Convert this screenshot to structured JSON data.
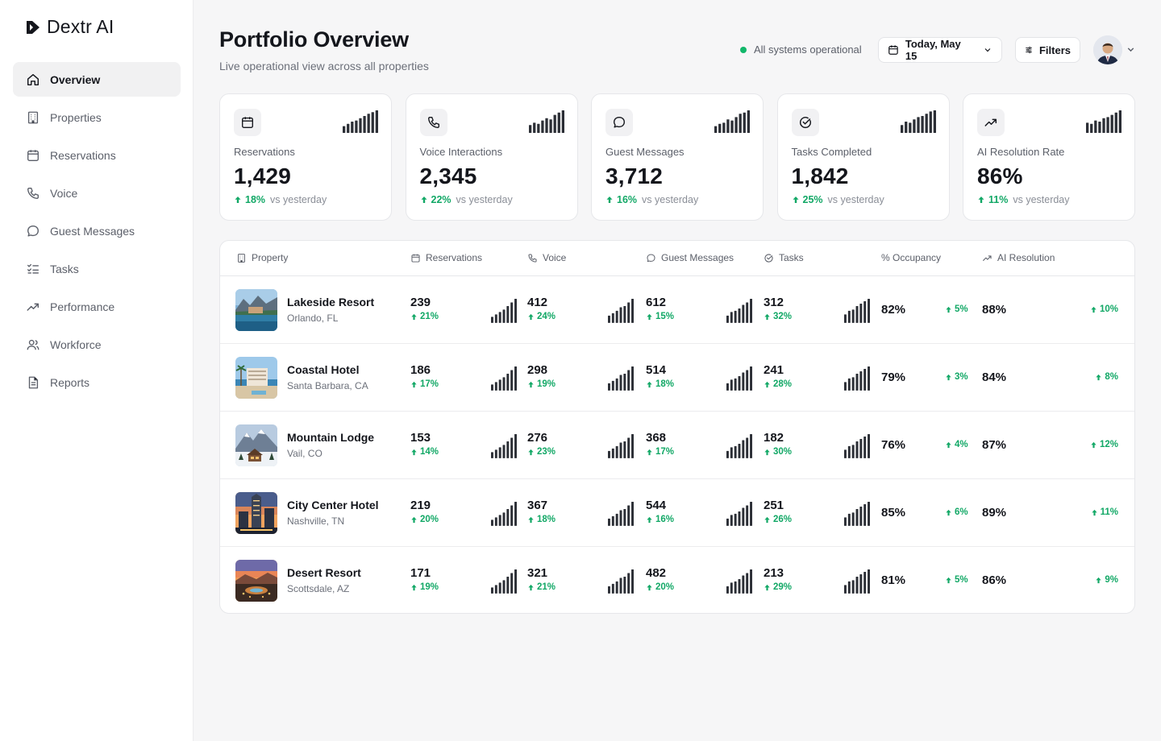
{
  "brand": {
    "name": "Dextr AI"
  },
  "sidebar": {
    "items": [
      {
        "label": "Overview",
        "icon": "home-icon",
        "active": true
      },
      {
        "label": "Properties",
        "icon": "building-icon"
      },
      {
        "label": "Reservations",
        "icon": "calendar-icon"
      },
      {
        "label": "Voice",
        "icon": "phone-icon"
      },
      {
        "label": "Guest Messages",
        "icon": "chat-bubble-icon"
      },
      {
        "label": "Tasks",
        "icon": "checklist-icon"
      },
      {
        "label": "Performance",
        "icon": "trend-up-icon"
      },
      {
        "label": "Workforce",
        "icon": "users-icon"
      },
      {
        "label": "Reports",
        "icon": "document-icon"
      }
    ]
  },
  "header": {
    "title": "Portfolio Overview",
    "subtitle": "Live operational view across all properties",
    "status": "All systems operational",
    "date_label": "Today, May 15",
    "filters_label": "Filters"
  },
  "kpis": [
    {
      "label": "Reservations",
      "value": "1,429",
      "delta": "18%",
      "vs": "vs yesterday",
      "icon": "calendar-icon",
      "spark": [
        0.3,
        0.4,
        0.5,
        0.55,
        0.65,
        0.75,
        0.85,
        0.92,
        1.0
      ]
    },
    {
      "label": "Voice Interactions",
      "value": "2,345",
      "delta": "22%",
      "vs": "vs yesterday",
      "icon": "phone-icon",
      "spark": [
        0.35,
        0.45,
        0.4,
        0.55,
        0.65,
        0.6,
        0.8,
        0.9,
        1.0
      ]
    },
    {
      "label": "Guest Messages",
      "value": "3,712",
      "delta": "16%",
      "vs": "vs yesterday",
      "icon": "chat-bubble-icon",
      "spark": [
        0.3,
        0.4,
        0.45,
        0.6,
        0.55,
        0.7,
        0.85,
        0.9,
        1.0
      ]
    },
    {
      "label": "Tasks Completed",
      "value": "1,842",
      "delta": "25%",
      "vs": "vs yesterday",
      "icon": "check-circle-icon",
      "spark": [
        0.35,
        0.5,
        0.45,
        0.6,
        0.7,
        0.75,
        0.85,
        0.95,
        1.0
      ]
    },
    {
      "label": "AI Resolution Rate",
      "value": "86%",
      "delta": "11%",
      "vs": "vs yesterday",
      "icon": "trend-up-icon",
      "spark": [
        0.45,
        0.4,
        0.55,
        0.5,
        0.65,
        0.7,
        0.8,
        0.9,
        1.0
      ]
    }
  ],
  "table": {
    "columns": [
      {
        "label": "Property",
        "icon": "building-icon"
      },
      {
        "label": "Reservations",
        "icon": "calendar-icon"
      },
      {
        "label": "Voice",
        "icon": "phone-icon"
      },
      {
        "label": "Guest Messages",
        "icon": "chat-bubble-icon"
      },
      {
        "label": "Tasks",
        "icon": "check-circle-icon"
      },
      {
        "label": "% Occupancy",
        "icon": ""
      },
      {
        "label": "AI Resolution",
        "icon": "trend-up-icon"
      }
    ],
    "rows": [
      {
        "name": "Lakeside Resort",
        "location": "Orlando, FL",
        "scene": "lake",
        "reservations": {
          "value": "239",
          "delta": "21%"
        },
        "voice": {
          "value": "412",
          "delta": "24%"
        },
        "messages": {
          "value": "612",
          "delta": "15%"
        },
        "tasks": {
          "value": "312",
          "delta": "32%"
        },
        "occupancy": {
          "value": "82%",
          "delta": "5%"
        },
        "ai": {
          "value": "88%",
          "delta": "10%"
        }
      },
      {
        "name": "Coastal Hotel",
        "location": "Santa Barbara, CA",
        "scene": "coast",
        "reservations": {
          "value": "186",
          "delta": "17%"
        },
        "voice": {
          "value": "298",
          "delta": "19%"
        },
        "messages": {
          "value": "514",
          "delta": "18%"
        },
        "tasks": {
          "value": "241",
          "delta": "28%"
        },
        "occupancy": {
          "value": "79%",
          "delta": "3%"
        },
        "ai": {
          "value": "84%",
          "delta": "8%"
        }
      },
      {
        "name": "Mountain Lodge",
        "location": "Vail, CO",
        "scene": "mountain",
        "reservations": {
          "value": "153",
          "delta": "14%"
        },
        "voice": {
          "value": "276",
          "delta": "23%"
        },
        "messages": {
          "value": "368",
          "delta": "17%"
        },
        "tasks": {
          "value": "182",
          "delta": "30%"
        },
        "occupancy": {
          "value": "76%",
          "delta": "4%"
        },
        "ai": {
          "value": "87%",
          "delta": "12%"
        }
      },
      {
        "name": "City Center Hotel",
        "location": "Nashville, TN",
        "scene": "city",
        "reservations": {
          "value": "219",
          "delta": "20%"
        },
        "voice": {
          "value": "367",
          "delta": "18%"
        },
        "messages": {
          "value": "544",
          "delta": "16%"
        },
        "tasks": {
          "value": "251",
          "delta": "26%"
        },
        "occupancy": {
          "value": "85%",
          "delta": "6%"
        },
        "ai": {
          "value": "89%",
          "delta": "11%"
        }
      },
      {
        "name": "Desert Resort",
        "location": "Scottsdale, AZ",
        "scene": "desert",
        "reservations": {
          "value": "171",
          "delta": "19%"
        },
        "voice": {
          "value": "321",
          "delta": "21%"
        },
        "messages": {
          "value": "482",
          "delta": "20%"
        },
        "tasks": {
          "value": "213",
          "delta": "29%"
        },
        "occupancy": {
          "value": "81%",
          "delta": "5%"
        },
        "ai": {
          "value": "86%",
          "delta": "9%"
        }
      }
    ]
  },
  "colors": {
    "accent_green": "#12a866",
    "status_green": "#12b76a",
    "text": "#14161c",
    "muted": "#5b5f69"
  }
}
